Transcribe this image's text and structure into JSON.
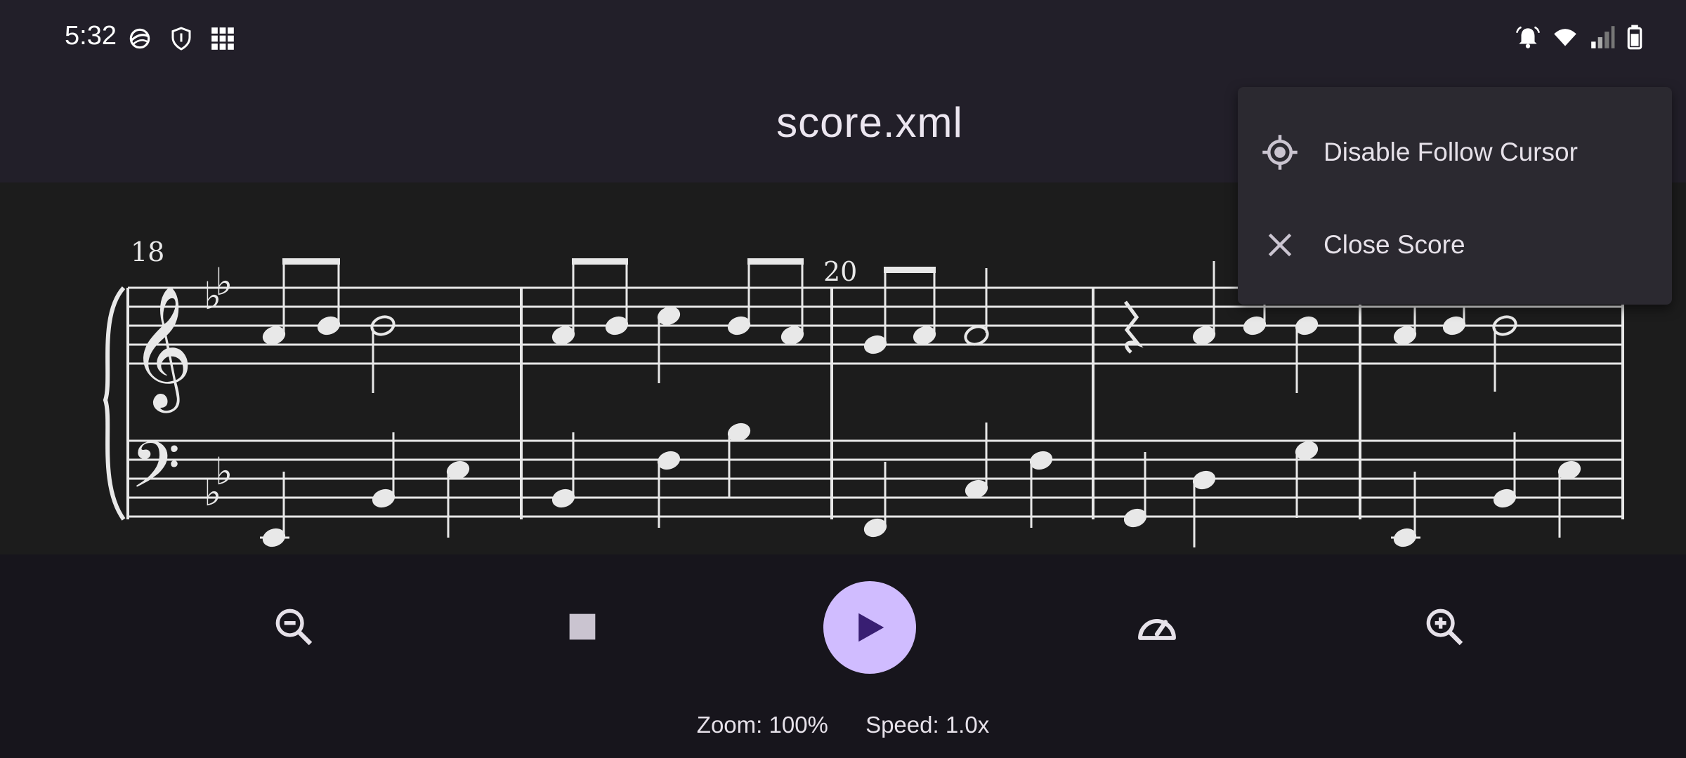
{
  "status_bar": {
    "time": "5:32",
    "left_icons": [
      "vpn-globe-icon",
      "shield-icon",
      "app-grid-icon"
    ],
    "right_icons": [
      "alarm-icon",
      "wifi-icon",
      "signal-icon",
      "battery-icon"
    ]
  },
  "app_bar": {
    "title": "score.xml"
  },
  "score": {
    "measure_numbers": [
      "18",
      "20"
    ]
  },
  "controls": {
    "zoom_out_icon": "zoom-out-icon",
    "stop_icon": "stop-icon",
    "play_icon": "play-icon",
    "speed_icon": "speedometer-icon",
    "zoom_in_icon": "zoom-in-icon",
    "zoom_text": "Zoom: 100%",
    "speed_text": "Speed: 1.0x"
  },
  "menu": {
    "items": [
      {
        "label": "Disable Follow Cursor",
        "icon": "target-icon"
      },
      {
        "label": "Close Score",
        "icon": "close-icon"
      }
    ]
  },
  "colors": {
    "accent": "#d0bcff",
    "surface": "#221f29",
    "score_bg": "#1c1c1c",
    "menu_bg": "#2b2930"
  }
}
